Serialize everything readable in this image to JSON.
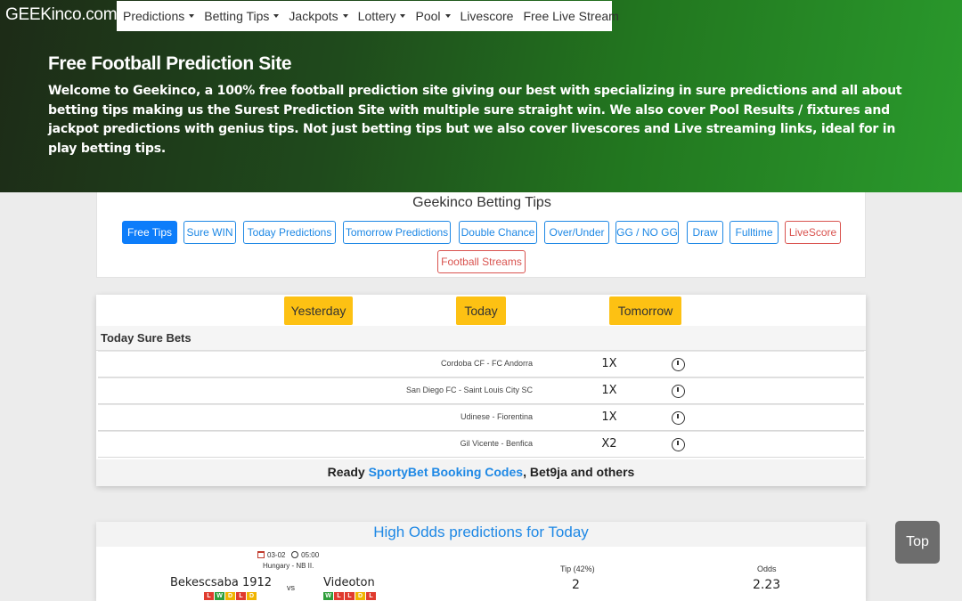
{
  "header": {
    "logo": "GEEKinco.com",
    "nav": [
      {
        "label": "Predictions",
        "dropdown": true
      },
      {
        "label": "Betting Tips",
        "dropdown": true
      },
      {
        "label": "Jackpots",
        "dropdown": true
      },
      {
        "label": "Lottery",
        "dropdown": true
      },
      {
        "label": "Pool",
        "dropdown": true
      },
      {
        "label": "Livescore",
        "dropdown": false
      },
      {
        "label": "Free Live Stream",
        "dropdown": false
      }
    ],
    "title": "Free Football Prediction Site",
    "intro": "Welcome to Geekinco, a 100% free football prediction site giving our best with specializing in sure predictions and all about betting tips making us the Surest Prediction Site with multiple sure straight win. We also cover Pool Results / fixtures and jackpot predictions with genius tips. Not just betting tips but we also cover livescores and Live streaming links, ideal for in play betting tips."
  },
  "tips": {
    "title": "Geekinco Betting Tips",
    "buttons": [
      "Free Tips",
      "Sure WIN",
      "Today Predictions",
      "Tomorrow Predictions",
      "Double Chance",
      "Over/Under",
      "GG / NO GG",
      "Draw",
      "Fulltime",
      "LiveScore",
      "Football Streams"
    ]
  },
  "predictions": {
    "days": [
      "Yesterday",
      "Today",
      "Tomorrow"
    ],
    "section_title": "Today Sure Bets",
    "rows": [
      {
        "match": "Cordoba CF - FC Andorra",
        "tip": "1X"
      },
      {
        "match": "San Diego FC - Saint Louis City SC",
        "tip": "1X"
      },
      {
        "match": "Udinese - Fiorentina",
        "tip": "1X"
      },
      {
        "match": "Gil Vicente - Benfica",
        "tip": "X2"
      }
    ],
    "footer_prefix": "Ready ",
    "footer_link": "SportyBet Booking Codes",
    "footer_suffix": ", Bet9ja and others"
  },
  "high_odds": {
    "title": "High Odds predictions for Today",
    "date": "03-02",
    "time": "05:00",
    "league": "Hungary - NB II.",
    "home": "Bekescsaba 1912",
    "away": "Videoton",
    "vs": "vs",
    "home_form": [
      "L",
      "W",
      "D",
      "L",
      "D"
    ],
    "away_form": [
      "W",
      "L",
      "L",
      "D",
      "L"
    ],
    "tip_label": "Tip (42%)",
    "tip_value": "2",
    "odds_label": "Odds",
    "odds_value": "2.23"
  },
  "top_button": "Top",
  "colors": {
    "accent": "#1e88e5",
    "day_button": "#fdc113",
    "active_button": "#0d7dfa",
    "danger": "#d9534f"
  }
}
